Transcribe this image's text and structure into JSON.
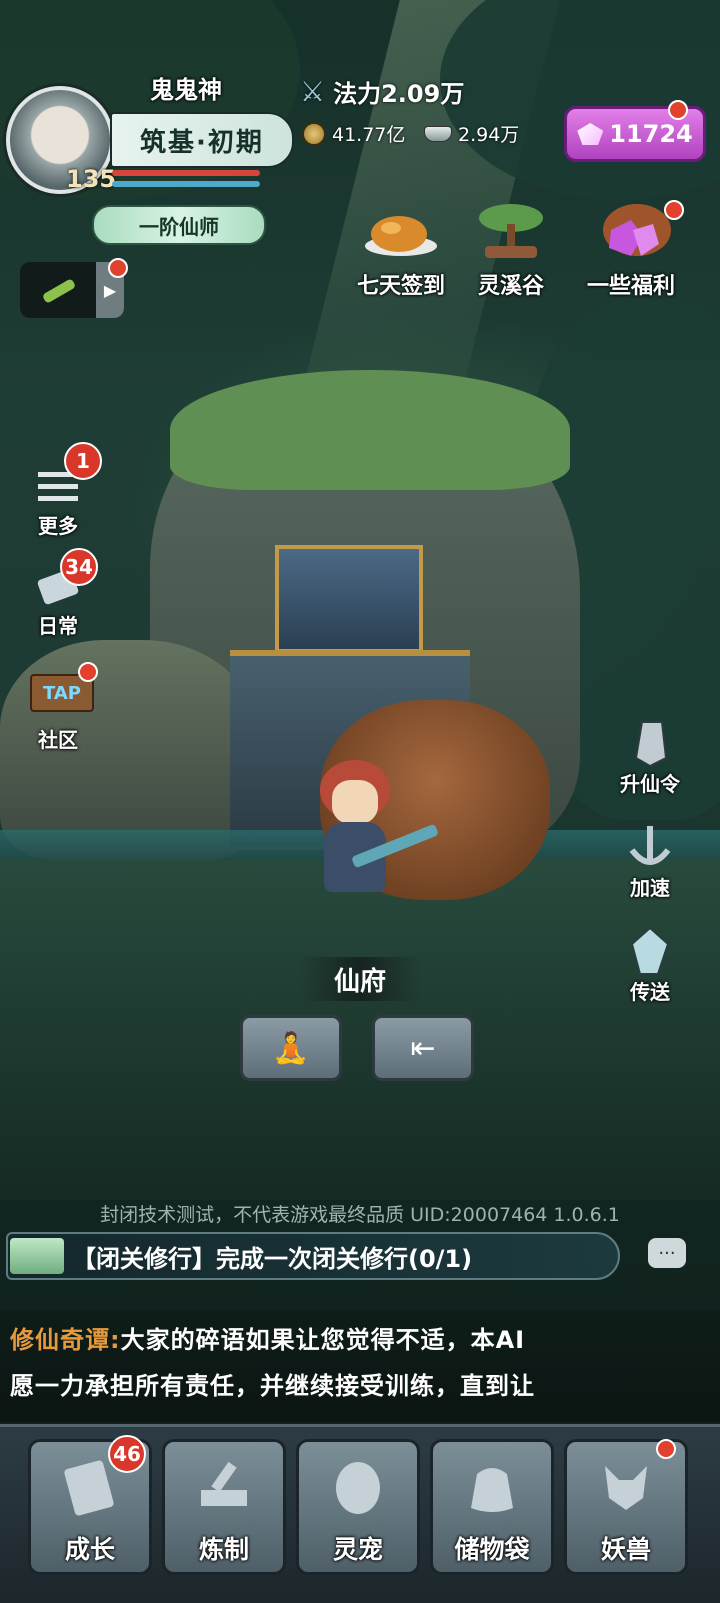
{
  "player": {
    "name": "鬼鬼神",
    "realm": "筑基·初期",
    "level": "135",
    "title": "一阶仙师",
    "hp_fraction": 1.0,
    "mp_fraction": 1.0
  },
  "stats": {
    "power_label": "法力2.09万",
    "copper": "41.77亿",
    "silver": "2.94万",
    "gems": "11724"
  },
  "top_features": [
    {
      "label": "七天签到",
      "icon": "roast-chicken-icon"
    },
    {
      "label": "灵溪谷",
      "icon": "bonsai-tree-icon"
    },
    {
      "label": "一些福利",
      "icon": "gem-bag-icon"
    }
  ],
  "left_menu": [
    {
      "label": "更多",
      "badge": "1",
      "icon": "list-icon"
    },
    {
      "label": "日常",
      "badge": "34",
      "icon": "scroll-icon"
    },
    {
      "label": "社区",
      "icon_text": "TAP",
      "icon": "tap-sign-icon"
    }
  ],
  "right_menu": [
    {
      "label": "升仙令",
      "icon": "token-icon"
    },
    {
      "label": "加速",
      "icon": "anchor-icon"
    },
    {
      "label": "传送",
      "icon": "crystal-icon"
    }
  ],
  "location": "仙府",
  "notice": "封闭技术测试，不代表游戏最终品质 UID:20007464 1.0.6.1",
  "quest": "【闭关修行】完成一次闭关修行(0/1)",
  "chat": {
    "channel": "修仙奇谭:",
    "line1": "大家的碎语如果让您觉得不适，本AI",
    "line2": "愿一力承担所有责任，并继续接受训练，直到让"
  },
  "bottom_nav": [
    {
      "label": "成长",
      "badge": "46",
      "icon": "book-icon"
    },
    {
      "label": "炼制",
      "icon": "anvil-icon"
    },
    {
      "label": "灵宠",
      "icon": "egg-icon"
    },
    {
      "label": "储物袋",
      "icon": "bag-icon"
    },
    {
      "label": "妖兽",
      "icon": "fox-icon"
    }
  ],
  "colors": {
    "accent_gem": "#c452d2",
    "badge_red": "#d8372a",
    "hp_red": "#d9443a",
    "mp_blue": "#4fa7c9"
  }
}
